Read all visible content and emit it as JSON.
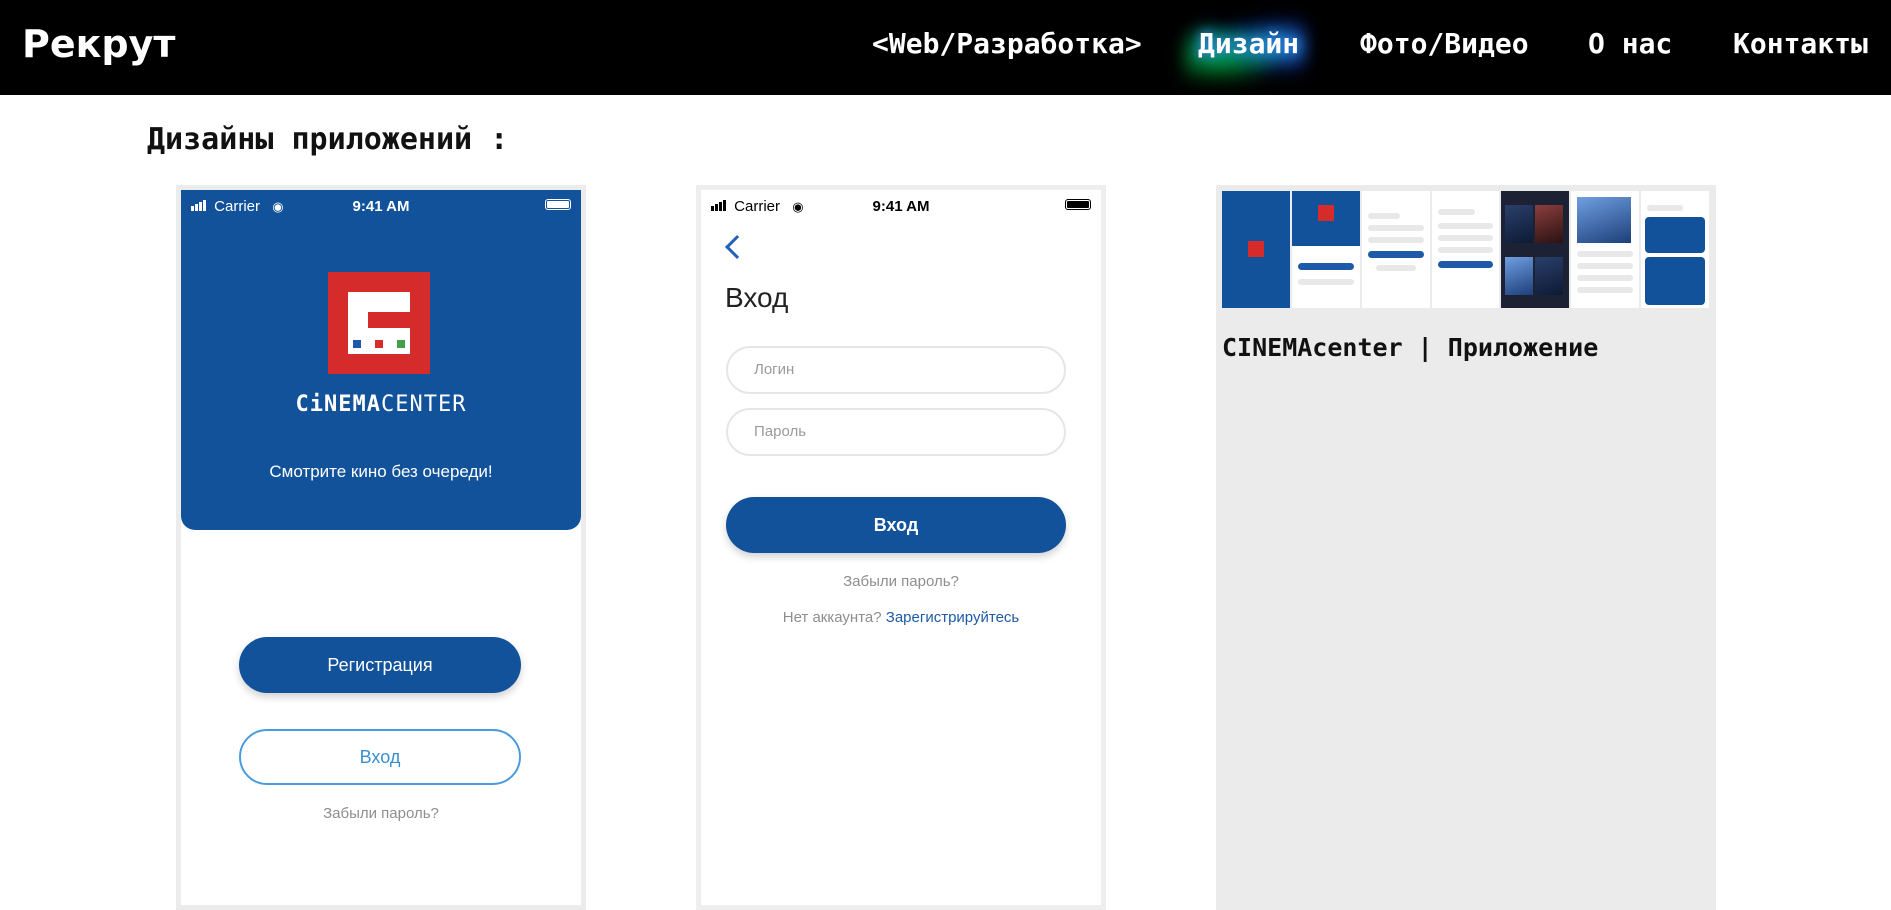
{
  "nav": {
    "brand": "Рекрут",
    "links": [
      {
        "label": "<Web/Разработка>",
        "active": false
      },
      {
        "label": "Дизайн",
        "active": true
      },
      {
        "label": "Фото/Видео",
        "active": false
      },
      {
        "label": "О нас",
        "active": false
      },
      {
        "label": "Контакты",
        "active": false
      }
    ],
    "active_glow_colors": [
      "#00c853",
      "#2962ff"
    ]
  },
  "section": {
    "title": "Дизайны приложений :"
  },
  "phone_welcome": {
    "status": {
      "carrier": "Carrier",
      "time": "9:41 AM"
    },
    "brand_bold": "CiNEMA",
    "brand_light": "CENTER",
    "tagline": "Смотрите кино без очереди!",
    "register_button": "Регистрация",
    "login_button": "Вход",
    "forgot_link": "Забыли пароль?",
    "logo_dot_colors": [
      "#1f5aa8",
      "#d52b2b",
      "#43a047"
    ]
  },
  "phone_login": {
    "status": {
      "carrier": "Carrier",
      "time": "9:41 AM"
    },
    "title": "Вход",
    "login_placeholder": "Логин",
    "password_placeholder": "Пароль",
    "submit_button": "Вход",
    "forgot_link": "Забыли пароль?",
    "no_account_text": "Нет аккаунта?",
    "register_link": "Зарегистрируйтесь"
  },
  "card": {
    "title": "CINEMAcenter | Приложение"
  },
  "colors": {
    "primary": "#12529a",
    "accent_red": "#d52b2b",
    "link": "#1f5aa8",
    "card_bg": "#ebebeb"
  }
}
